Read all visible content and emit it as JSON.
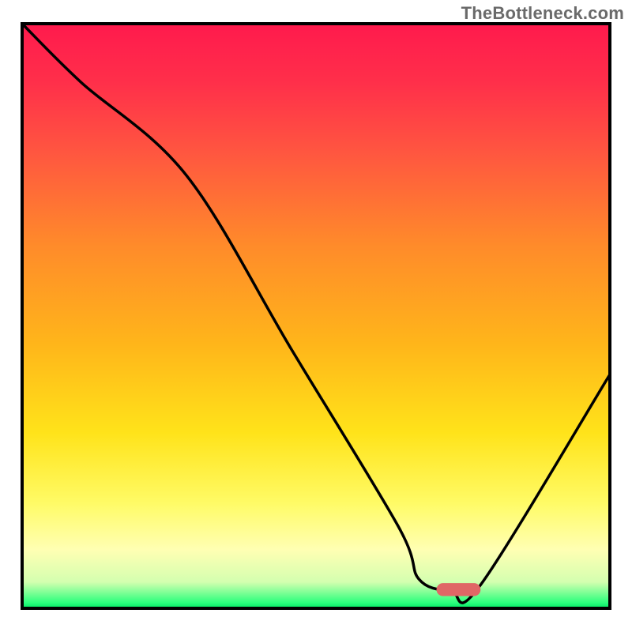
{
  "watermark": "TheBottleneck.com",
  "chart_data": {
    "type": "line",
    "title": "",
    "xlabel": "",
    "ylabel": "",
    "xlim": [
      0,
      100
    ],
    "ylim": [
      0,
      100
    ],
    "grid": false,
    "gradient_stops": [
      {
        "offset": 0.0,
        "color": "#ff1a4d"
      },
      {
        "offset": 0.1,
        "color": "#ff2f4a"
      },
      {
        "offset": 0.22,
        "color": "#ff5640"
      },
      {
        "offset": 0.38,
        "color": "#ff8b2a"
      },
      {
        "offset": 0.55,
        "color": "#ffb61a"
      },
      {
        "offset": 0.7,
        "color": "#ffe31a"
      },
      {
        "offset": 0.82,
        "color": "#fffb66"
      },
      {
        "offset": 0.9,
        "color": "#ffffb3"
      },
      {
        "offset": 0.955,
        "color": "#d4ffb0"
      },
      {
        "offset": 0.99,
        "color": "#2dff7d"
      },
      {
        "offset": 1.0,
        "color": "#00e864"
      }
    ],
    "series": [
      {
        "name": "bottleneck-curve",
        "x": [
          0,
          10,
          28,
          46,
          64,
          67.5,
          73,
          78,
          100
        ],
        "y": [
          100,
          90,
          74,
          44,
          14,
          5,
          3,
          4,
          40
        ]
      }
    ],
    "marker": {
      "name": "optimal-bar",
      "color": "#e06666",
      "x_start": 70.5,
      "x_end": 78.0,
      "y": 3.2,
      "height": 2.2
    },
    "border_width_px": 4,
    "border_color": "#000000"
  }
}
